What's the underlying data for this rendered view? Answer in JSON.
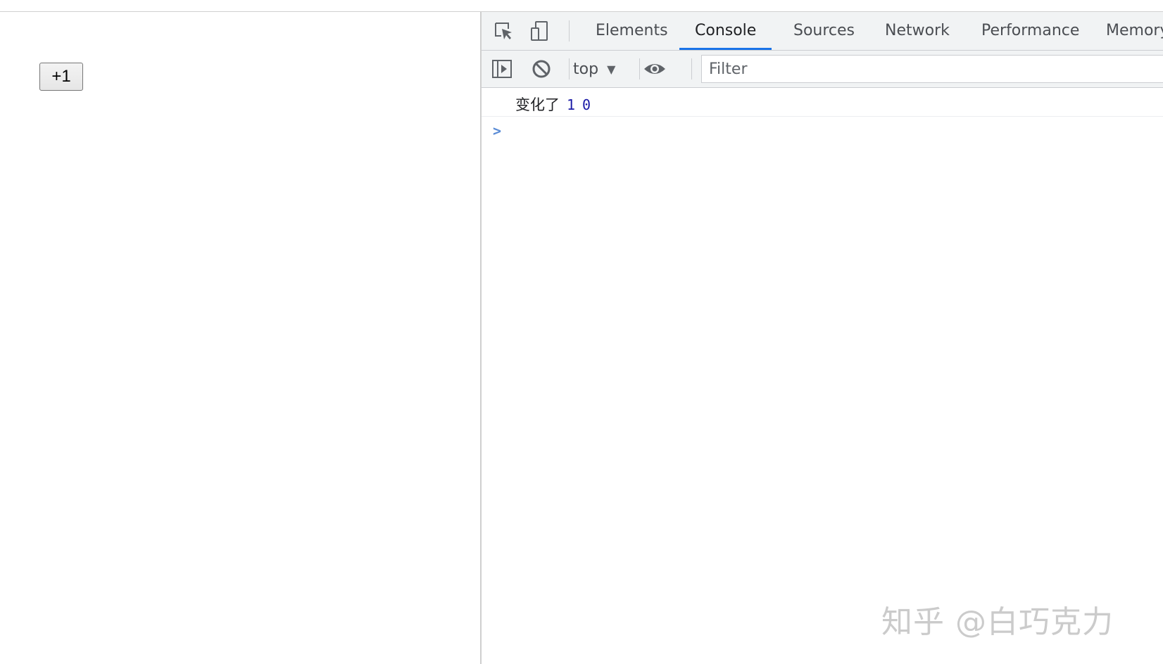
{
  "page": {
    "increment_button_label": "+1"
  },
  "devtools": {
    "tabs": [
      {
        "label": "Elements",
        "active": false
      },
      {
        "label": "Console",
        "active": true
      },
      {
        "label": "Sources",
        "active": false
      },
      {
        "label": "Network",
        "active": false
      },
      {
        "label": "Performance",
        "active": false
      },
      {
        "label": "Memory",
        "active": false
      }
    ],
    "icons": {
      "inspect": "inspect-element-icon",
      "device": "device-toolbar-icon",
      "sidebar": "console-sidebar-icon",
      "clear": "clear-console-icon",
      "eye": "live-expression-icon",
      "dropdown": "chevron-down-icon"
    },
    "toolbar": {
      "context": "top",
      "filter_placeholder": "Filter",
      "filter_value": ""
    },
    "console": {
      "log_text": "变化了",
      "log_values": [
        "1",
        "0"
      ],
      "prompt_symbol": ">"
    },
    "accent_color": "#1a73e8"
  },
  "watermark": "知乎 @白巧克力"
}
